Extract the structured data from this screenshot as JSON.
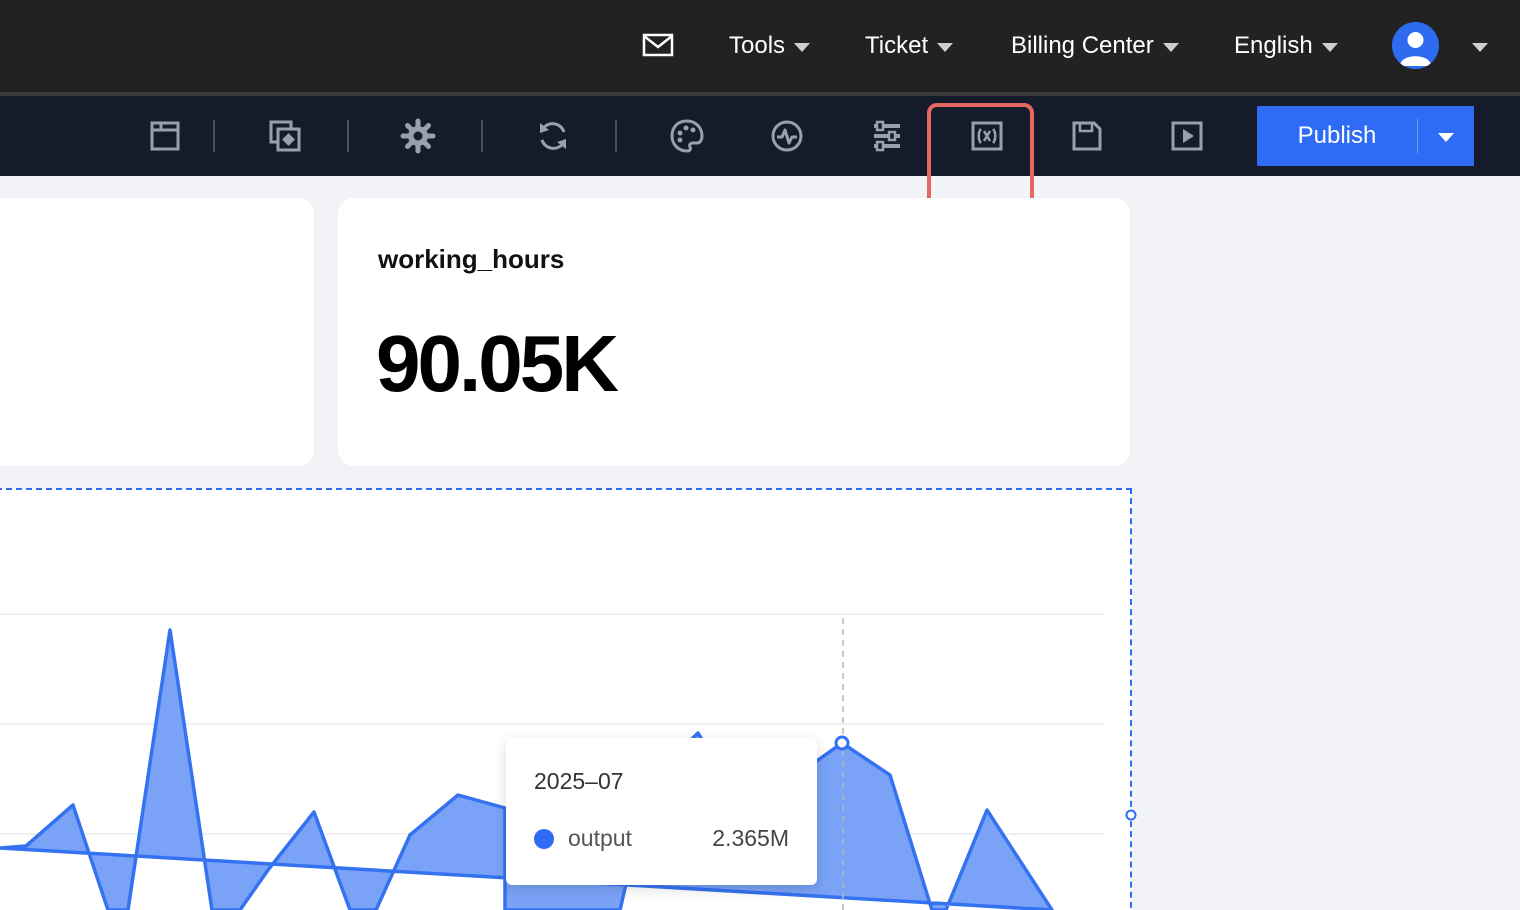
{
  "header": {
    "menu": [
      {
        "label": "Tools"
      },
      {
        "label": "Ticket"
      },
      {
        "label": "Billing Center"
      },
      {
        "label": "English"
      }
    ],
    "icons": [
      "mail-icon",
      "user-avatar-icon"
    ]
  },
  "toolbar": {
    "icons": [
      "panel-icon",
      "layers-icon",
      "settings-icon",
      "refresh-icon",
      "palette-icon",
      "activity-icon",
      "filter-icon",
      "variable-icon",
      "save-icon",
      "preview-icon"
    ],
    "highlighted": "variable-icon",
    "publish_label": "Publish"
  },
  "metric_card": {
    "title": "working_hours",
    "value": "90.05K"
  },
  "chart_data": {
    "type": "area",
    "series": [
      {
        "name": "output"
      }
    ],
    "tooltip": {
      "date": "2025–07",
      "series": "output",
      "value": "2.365M"
    },
    "color": "#2e6cf6"
  },
  "colors": {
    "accent": "#2e6cf6",
    "highlight": "#e5675f",
    "topbar": "#222222",
    "toolbar": "#151b2a"
  }
}
